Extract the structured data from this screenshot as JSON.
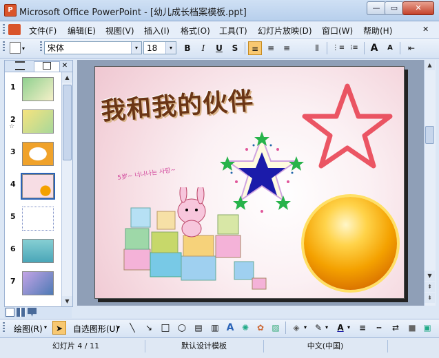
{
  "window": {
    "title": "Microsoft Office PowerPoint - [幼儿成长档案模板.ppt]",
    "app_icon": "P"
  },
  "window_controls": {
    "minimize": "—",
    "restore": "▭",
    "close": "✕"
  },
  "menu": {
    "items": [
      "文件(F)",
      "编辑(E)",
      "视图(V)",
      "插入(I)",
      "格式(O)",
      "工具(T)",
      "幻灯片放映(D)",
      "窗口(W)",
      "帮助(H)"
    ],
    "close_glyph": "✕"
  },
  "format_toolbar": {
    "font_name": "宋体",
    "font_size": "18",
    "bold": "B",
    "italic": "I",
    "underline": "U",
    "shadow": "S",
    "align_left": "≡",
    "center": "≡",
    "align_right": "≡",
    "distribute": "⫴",
    "numbering": "⋮≡",
    "bullets": "⁝≡",
    "grow_font": "A",
    "shrink_font": "A",
    "decrease_indent": "⇤"
  },
  "slides_pane": {
    "tab_outline_icon": "outline-tab-icon",
    "tab_slides_icon": "slides-tab-icon",
    "close": "✕",
    "thumbnails": [
      {
        "number": "1",
        "colors": [
          "#8fd08f",
          "#f5f0c8"
        ]
      },
      {
        "number": "2",
        "colors": [
          "#f6e37e",
          "#a8d89a"
        ],
        "has_animation": true
      },
      {
        "number": "3",
        "colors": [
          "#f0a22a",
          "#ffffff"
        ]
      },
      {
        "number": "4",
        "colors": [
          "#f7dde4",
          "#3b2a20"
        ],
        "selected": true
      },
      {
        "number": "5",
        "colors": [
          "#ffffff",
          "#b9c6e6"
        ]
      },
      {
        "number": "6",
        "colors": [
          "#86cfd3",
          "#4aa6b8"
        ]
      },
      {
        "number": "7",
        "colors": [
          "#c3a4e6",
          "#4e7ab5"
        ]
      }
    ],
    "animation_glyph": "☆"
  },
  "slide": {
    "title": "我和我的伙伴",
    "handwriting": "5岁~ 너나나는 사랑~",
    "colors": {
      "title": "#6b3515",
      "star_outline": "#e83a4a",
      "big_star": "#1b1baa",
      "ball": "#f4a100"
    }
  },
  "drawing_toolbar": {
    "draw_menu": "绘图(R)",
    "autoshapes_menu": "自选图形(U)",
    "select_arrow": "➤",
    "line": "╲",
    "arrow": "↘",
    "rect": "□",
    "oval": "○",
    "textbox": "▤",
    "vertical_textbox": "▥",
    "wordart": "A",
    "diagram": "✺",
    "clipart": "✿",
    "picture": "▨",
    "fill_color": "◈",
    "line_color": "✎",
    "font_color": "A",
    "line_style": "≡",
    "dash_style": "┅",
    "arrow_style": "⇄",
    "shadow_style": "■",
    "3d_style": "▣",
    "dropdown": "▾"
  },
  "status": {
    "slide": "幻灯片 4 / 11",
    "design": "默认设计模板",
    "language": "中文(中国)"
  },
  "scroll": {
    "up": "▲",
    "down": "▼",
    "prev_slide": "⇞",
    "next_slide": "⇟"
  }
}
